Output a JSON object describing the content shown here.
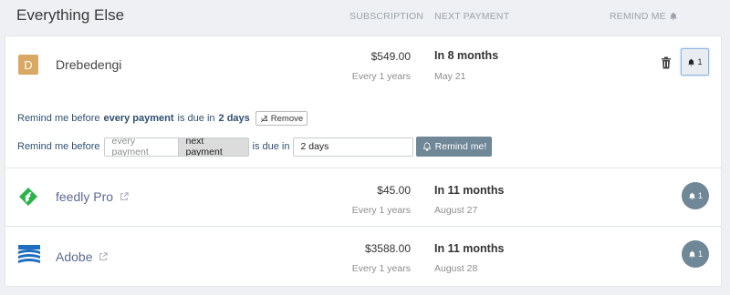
{
  "header": {
    "title": "Everything Else",
    "col_subscription": "SUBSCRIPTION",
    "col_next_payment": "NEXT PAYMENT",
    "col_remind_me": "REMIND ME"
  },
  "subscriptions": [
    {
      "logo_letter": "D",
      "name": "Drebedengi",
      "price": "$549.00",
      "every": "Every 1 years",
      "due": "In 8 months",
      "date": "May 21",
      "reminders": "1"
    },
    {
      "name": "feedly Pro",
      "price": "$45.00",
      "every": "Every 1 years",
      "due": "In 11 months",
      "date": "August 27",
      "reminders": "1"
    },
    {
      "name": "Adobe",
      "price": "$3588.00",
      "every": "Every 1 years",
      "due": "In 11 months",
      "date": "August 28",
      "reminders": "1"
    }
  ],
  "reminder": {
    "prefix": "Remind me before",
    "bold1": "every payment",
    "mid": "is due in",
    "bold2": "2 days",
    "remove_label": "Remove"
  },
  "form": {
    "label_before": "Remind me before",
    "opt_every": "every payment",
    "opt_next": "next payment",
    "label_due_in": "is due in",
    "days_value": "2 days",
    "submit_label": "Remind me!"
  },
  "colors": {
    "accent": "#6f8796",
    "drebedengi_logo": "#d9a862",
    "feedly_logo": "#2bb24c",
    "adobe_logo": "#1e6fc0"
  }
}
